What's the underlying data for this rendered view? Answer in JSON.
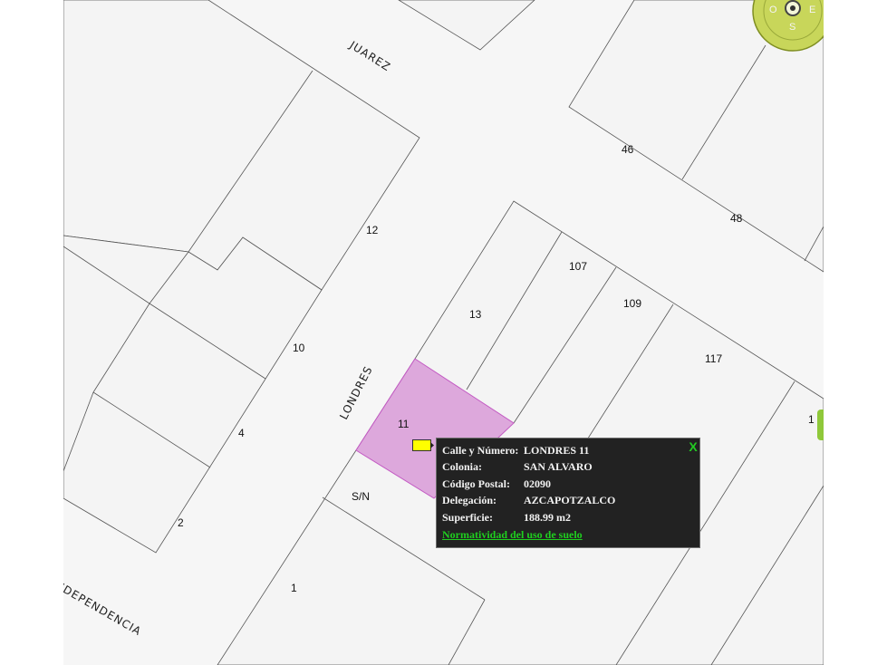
{
  "map": {
    "streets": {
      "juarez": "JUAREZ",
      "londres": "LONDRES",
      "independencia": "NDEPENDENCIA"
    },
    "lot_numbers": {
      "n46": "46",
      "n48": "48",
      "n12": "12",
      "n107": "107",
      "n13": "13",
      "n109": "109",
      "n10": "10",
      "n117": "117",
      "n11": "11",
      "n4": "4",
      "n1x": "1",
      "n2": "2",
      "nsn": "S/N",
      "n1": "1"
    },
    "compass": {
      "west": "O",
      "east": "E",
      "south": "S"
    },
    "colors": {
      "selected_lot": "#dda8dc",
      "selected_lot_border": "#c35ac3",
      "compass": "#c8d65a",
      "pin": "#ffff00"
    }
  },
  "popup": {
    "close_label": "X",
    "rows": [
      {
        "key": "Calle y Número:",
        "value": "LONDRES 11"
      },
      {
        "key": "Colonia:",
        "value": "SAN ALVARO"
      },
      {
        "key": "Código Postal:",
        "value": "02090"
      },
      {
        "key": "Delegación:",
        "value": "AZCAPOTZALCO"
      },
      {
        "key": "Superficie:",
        "value": "188.99 m2"
      }
    ],
    "link": "Normatividad del uso de suelo"
  }
}
